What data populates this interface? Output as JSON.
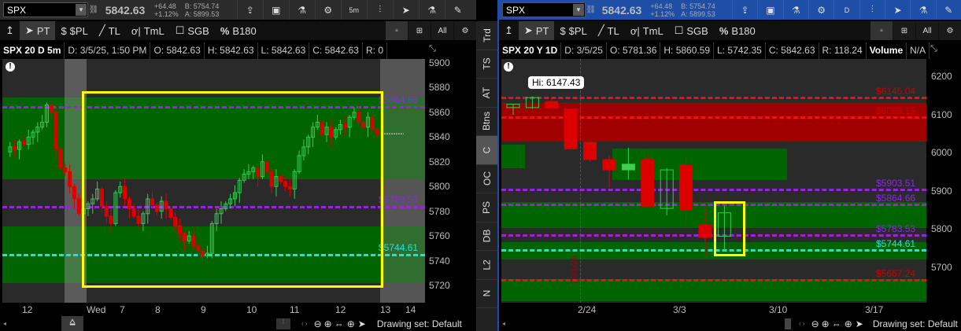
{
  "left": {
    "symbol": "SPX",
    "last": "5842.63",
    "change": "+64.48",
    "change_pct": "+1.12%",
    "bid": "B: 5754.74",
    "ask": "A: 5899.53",
    "aggregation_btn": "5m",
    "tools": {
      "pt": "PT",
      "spl": "$PL",
      "tl": "TL",
      "tml": "TmL",
      "sgb": "SGB",
      "b180": "B180"
    },
    "info": {
      "title": "SPX 20 D 5m",
      "date": "D: 3/5/25, 1:50 PM",
      "open": "O: 5842.63",
      "high": "H: 5842.63",
      "low": "L: 5842.63",
      "close": "C: 5842.63",
      "range": "R: 0"
    },
    "drawing_set": "Drawing set: Default"
  },
  "right": {
    "symbol": "SPX",
    "last": "5842.63",
    "change": "+64.48",
    "change_pct": "+1.12%",
    "bid": "B: 5754.74",
    "ask": "A: 5899.53",
    "aggregation_btn": "D",
    "tools": {
      "pt": "PT",
      "spl": "$PL",
      "tl": "TL",
      "tml": "TmL",
      "sgb": "SGB",
      "b180": "B180"
    },
    "info": {
      "title": "SPX 20 Y 1D",
      "date": "D: 3/5/25",
      "open": "O: 5781.36",
      "high": "H: 5860.59",
      "low": "L: 5742.35",
      "close": "C: 5842.63",
      "range": "R: 118.24",
      "volume": "Volume",
      "volume_val": "N/A"
    },
    "hi_bubble": "Hi: 6147.43",
    "vline_label": "2/21/25",
    "drawing_set": "Drawing set: Default"
  },
  "side_tabs": [
    "Trd",
    "TS",
    "AT",
    "Btns",
    "C",
    "OC",
    "PS",
    "DB",
    "L2",
    "N"
  ],
  "colors": {
    "up": "#33cc55",
    "down": "#dd0000",
    "zone_green": "#006400",
    "zone_red": "#a00000",
    "purple": "#a020e0",
    "cyan": "#20e0e0",
    "red_line": "#ee1111",
    "highlight": "#ffff00",
    "bg": "#2a2a2a"
  },
  "chart_data": [
    {
      "type": "candlestick",
      "title": "SPX 20 D 5m",
      "ylim": [
        5710,
        5905
      ],
      "yticks": [
        "5900",
        "5880",
        "5860",
        "5840",
        "5820",
        "5800",
        "5780",
        "5760",
        "5740",
        "5720"
      ],
      "xticks": [
        "12",
        "Wed",
        "7",
        "8",
        "9",
        "10",
        "11",
        "12",
        "13",
        "14"
      ],
      "closes": [
        5828,
        5832,
        5830,
        5836,
        5834,
        5840,
        5844,
        5848,
        5852,
        5866,
        5860,
        5830,
        5815,
        5812,
        5800,
        5790,
        5778,
        5782,
        5786,
        5790,
        5798,
        5784,
        5776,
        5770,
        5795,
        5800,
        5790,
        5782,
        5776,
        5770,
        5778,
        5790,
        5785,
        5780,
        5788,
        5782,
        5775,
        5768,
        5762,
        5756,
        5760,
        5752,
        5748,
        5744,
        5746,
        5770,
        5778,
        5782,
        5786,
        5790,
        5795,
        5805,
        5810,
        5812,
        5815,
        5808,
        5820,
        5812,
        5800,
        5808,
        5804,
        5800,
        5798,
        5812,
        5825,
        5832,
        5840,
        5848,
        5852,
        5842,
        5848,
        5840,
        5846,
        5850,
        5848,
        5856,
        5860,
        5852,
        5848,
        5856,
        5846,
        5842
      ],
      "levels": [
        {
          "label": "$5864.66",
          "value": 5864.66,
          "color": "purple"
        },
        {
          "label": "$5783.53",
          "value": 5783.53,
          "color": "purple"
        },
        {
          "label": "$5744.61",
          "value": 5744.61,
          "color": "cyan"
        }
      ],
      "zones": [
        {
          "from": 5806,
          "to": 5872,
          "color": "green"
        },
        {
          "from": 5722,
          "to": 5768,
          "color": "green"
        }
      ]
    },
    {
      "type": "candlestick",
      "title": "SPX 20 Y 1D",
      "ylim": [
        5620,
        6230
      ],
      "yticks": [
        "6200",
        "6100",
        "6000",
        "5900",
        "5800",
        "5700"
      ],
      "xticks": [
        "2/24",
        "3/3",
        "3/10",
        "3/17"
      ],
      "ohlc": [
        [
          6118,
          6128,
          6099,
          6127
        ],
        [
          6118,
          6147.43,
          6115,
          6144
        ],
        [
          6134,
          6140,
          6110,
          6117
        ],
        [
          6114,
          6114,
          6008,
          6010
        ],
        [
          6027,
          6030,
          5976,
          5982
        ],
        [
          5982,
          5992,
          5908,
          5955
        ],
        [
          5955,
          6013,
          5930,
          5970
        ],
        [
          5982,
          5994,
          5858,
          5860
        ],
        [
          5854,
          5960,
          5836,
          5955
        ],
        [
          5967,
          5988,
          5811,
          5850
        ],
        [
          5811,
          5860,
          5731,
          5778
        ],
        [
          5781.36,
          5860.59,
          5742.35,
          5842.63
        ]
      ],
      "levels": [
        {
          "label": "$6145.04",
          "value": 6145.04,
          "color": "red"
        },
        {
          "label": "$6093.15",
          "value": 6093.15,
          "color": "red"
        },
        {
          "label": "$5903.51",
          "value": 5903.51,
          "color": "purple"
        },
        {
          "label": "$5864.66",
          "value": 5864.66,
          "color": "purple"
        },
        {
          "label": "$5783.53",
          "value": 5783.53,
          "color": "purple"
        },
        {
          "label": "$5744.61",
          "value": 5744.61,
          "color": "cyan"
        },
        {
          "label": "$5667.24",
          "value": 5667.24,
          "color": "red"
        }
      ]
    }
  ]
}
